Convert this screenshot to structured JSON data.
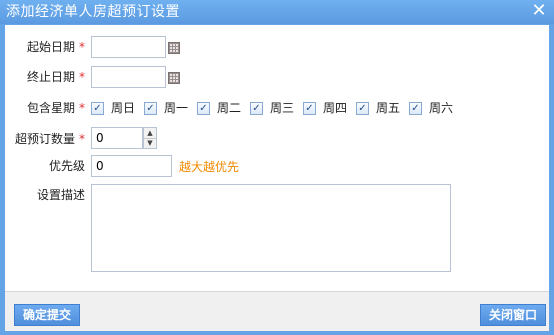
{
  "window": {
    "title": "添加经济单人房超预订设置",
    "close_symbol": "✕"
  },
  "form": {
    "start_date": {
      "label": "起始日期",
      "required_mark": "*",
      "value": "",
      "icon": "calendar-icon"
    },
    "end_date": {
      "label": "终止日期",
      "required_mark": "*",
      "value": "",
      "icon": "calendar-icon"
    },
    "weekdays": {
      "label": "包含星期",
      "required_mark": "*",
      "days": [
        {
          "label": "周日",
          "checked": true
        },
        {
          "label": "周一",
          "checked": true
        },
        {
          "label": "周二",
          "checked": true
        },
        {
          "label": "周三",
          "checked": true
        },
        {
          "label": "周四",
          "checked": true
        },
        {
          "label": "周五",
          "checked": true
        },
        {
          "label": "周六",
          "checked": true
        }
      ]
    },
    "overbooking": {
      "label": "超预订数量",
      "required_mark": "*",
      "value": "0"
    },
    "priority": {
      "label": "优先级",
      "value": "0",
      "hint": "越大越优先"
    },
    "description": {
      "label": "设置描述",
      "value": ""
    }
  },
  "footer": {
    "submit_label": "确定提交",
    "close_label": "关闭窗口"
  },
  "colors": {
    "titlebar": "#5b9ae0",
    "required": "#e03030",
    "hint": "#f08a00"
  }
}
